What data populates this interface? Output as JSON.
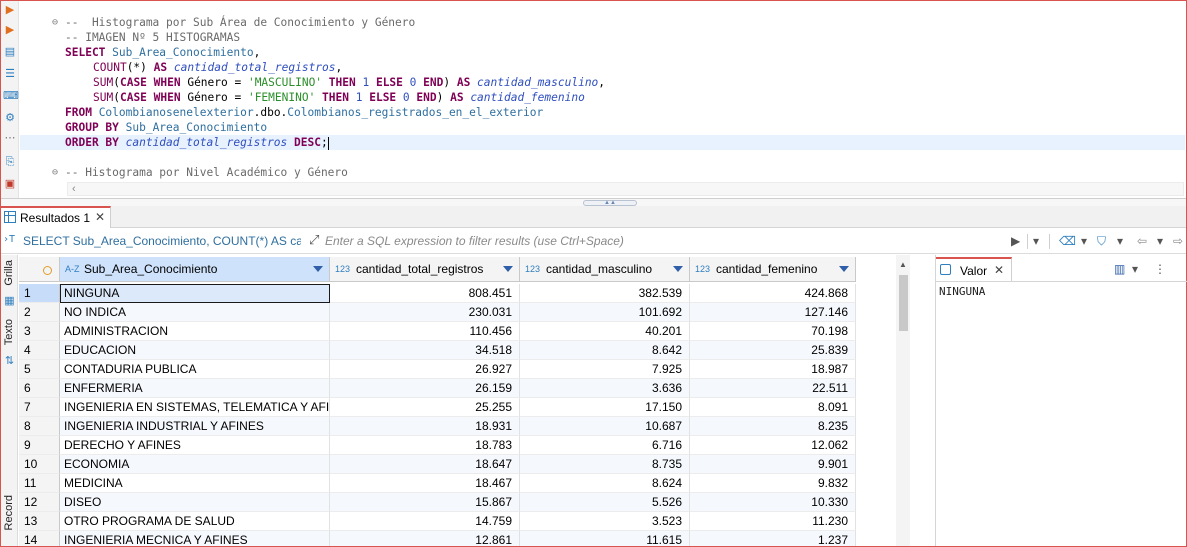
{
  "editor": {
    "lines": [
      {
        "parts": [
          {
            "t": "--  Histograma por Sub Área de Conocimiento y Género",
            "c": "cm"
          }
        ],
        "fold": "⊖",
        "indent": 0
      },
      {
        "parts": [
          {
            "t": "-- IMAGEN Nº 5 HISTOGRAMAS",
            "c": "cm"
          }
        ],
        "indent": 0
      },
      {
        "parts": [
          {
            "t": "SELECT ",
            "c": "kw"
          },
          {
            "t": "Sub_Area_Conocimiento",
            "c": "id"
          },
          {
            "t": ",",
            "c": "op"
          }
        ],
        "indent": 0
      },
      {
        "parts": [
          {
            "t": "COUNT",
            "c": "fn"
          },
          {
            "t": "(*) ",
            "c": "op"
          },
          {
            "t": "AS ",
            "c": "kw"
          },
          {
            "t": "cantidad_total_registros",
            "c": "al"
          },
          {
            "t": ",",
            "c": "op"
          }
        ],
        "indent": 4
      },
      {
        "parts": [
          {
            "t": "SUM",
            "c": "fn"
          },
          {
            "t": "(",
            "c": "op"
          },
          {
            "t": "CASE WHEN ",
            "c": "kw"
          },
          {
            "t": "Género = ",
            "c": "op"
          },
          {
            "t": "'MASCULINO'",
            "c": "st"
          },
          {
            "t": " THEN ",
            "c": "kw"
          },
          {
            "t": "1",
            "c": "nm"
          },
          {
            "t": " ELSE ",
            "c": "kw"
          },
          {
            "t": "0",
            "c": "nm"
          },
          {
            "t": " END",
            "c": "kw"
          },
          {
            "t": ") ",
            "c": "op"
          },
          {
            "t": "AS ",
            "c": "kw"
          },
          {
            "t": "cantidad_masculino",
            "c": "al"
          },
          {
            "t": ",",
            "c": "op"
          }
        ],
        "indent": 4
      },
      {
        "parts": [
          {
            "t": "SUM",
            "c": "fn"
          },
          {
            "t": "(",
            "c": "op"
          },
          {
            "t": "CASE WHEN ",
            "c": "kw"
          },
          {
            "t": "Género = ",
            "c": "op"
          },
          {
            "t": "'FEMENINO'",
            "c": "st"
          },
          {
            "t": " THEN ",
            "c": "kw"
          },
          {
            "t": "1",
            "c": "nm"
          },
          {
            "t": " ELSE ",
            "c": "kw"
          },
          {
            "t": "0",
            "c": "nm"
          },
          {
            "t": " END",
            "c": "kw"
          },
          {
            "t": ") ",
            "c": "op"
          },
          {
            "t": "AS ",
            "c": "kw"
          },
          {
            "t": "cantidad_femenino",
            "c": "al"
          }
        ],
        "indent": 4
      },
      {
        "parts": [
          {
            "t": "FROM ",
            "c": "kw"
          },
          {
            "t": "Colombianosenelexterior",
            "c": "id"
          },
          {
            "t": ".dbo.",
            "c": "op"
          },
          {
            "t": "Colombianos_registrados_en_el_exterior",
            "c": "id"
          }
        ],
        "indent": 0
      },
      {
        "parts": [
          {
            "t": "GROUP BY ",
            "c": "kw"
          },
          {
            "t": "Sub_Area_Conocimiento",
            "c": "id"
          }
        ],
        "indent": 0
      },
      {
        "parts": [
          {
            "t": "ORDER BY ",
            "c": "kw"
          },
          {
            "t": "cantidad_total_registros",
            "c": "al"
          },
          {
            "t": " DESC",
            "c": "kw"
          },
          {
            "t": ";",
            "c": "op"
          }
        ],
        "indent": 0,
        "current": true
      },
      {
        "parts": [],
        "indent": 0
      },
      {
        "parts": [
          {
            "t": "-- Histograma por Nivel Académico y Género",
            "c": "cm"
          }
        ],
        "fold": "⊖",
        "indent": 0
      }
    ]
  },
  "results_tab": {
    "label": "Resultados 1"
  },
  "filter_bar": {
    "query_preview": "SELECT Sub_Area_Conocimiento, COUNT(*) AS canti",
    "placeholder": "Enter a SQL expression to filter results (use Ctrl+Space)"
  },
  "side_panel": {
    "grid_label": "Grilla",
    "text_label": "Texto",
    "record_label": "Record"
  },
  "grid": {
    "columns": [
      {
        "type": "A-Z",
        "name": "Sub_Area_Conocimiento"
      },
      {
        "type": "123",
        "name": "cantidad_total_registros"
      },
      {
        "type": "123",
        "name": "cantidad_masculino"
      },
      {
        "type": "123",
        "name": "cantidad_femenino"
      }
    ],
    "rows": [
      {
        "n": "1",
        "area": "NINGUNA",
        "total": "808.451",
        "masc": "382.539",
        "fem": "424.868"
      },
      {
        "n": "2",
        "area": "NO INDICA",
        "total": "230.031",
        "masc": "101.692",
        "fem": "127.146"
      },
      {
        "n": "3",
        "area": "ADMINISTRACION",
        "total": "110.456",
        "masc": "40.201",
        "fem": "70.198"
      },
      {
        "n": "4",
        "area": "EDUCACION",
        "total": "34.518",
        "masc": "8.642",
        "fem": "25.839"
      },
      {
        "n": "5",
        "area": "CONTADURIA PUBLICA",
        "total": "26.927",
        "masc": "7.925",
        "fem": "18.987"
      },
      {
        "n": "6",
        "area": "ENFERMERIA",
        "total": "26.159",
        "masc": "3.636",
        "fem": "22.511"
      },
      {
        "n": "7",
        "area": "INGENIERIA EN SISTEMAS, TELEMATICA Y AFINES",
        "total": "25.255",
        "masc": "17.150",
        "fem": "8.091"
      },
      {
        "n": "8",
        "area": "INGENIERIA INDUSTRIAL Y AFINES",
        "total": "18.931",
        "masc": "10.687",
        "fem": "8.235"
      },
      {
        "n": "9",
        "area": "DERECHO Y AFINES",
        "total": "18.783",
        "masc": "6.716",
        "fem": "12.062"
      },
      {
        "n": "10",
        "area": "ECONOMIA",
        "total": "18.647",
        "masc": "8.735",
        "fem": "9.901"
      },
      {
        "n": "11",
        "area": "MEDICINA",
        "total": "18.467",
        "masc": "8.624",
        "fem": "9.832"
      },
      {
        "n": "12",
        "area": "DISEO",
        "total": "15.867",
        "masc": "5.526",
        "fem": "10.330"
      },
      {
        "n": "13",
        "area": "OTRO PROGRAMA DE SALUD",
        "total": "14.759",
        "masc": "3.523",
        "fem": "11.230"
      },
      {
        "n": "14",
        "area": "INGENIERIA MECNICA Y AFINES",
        "total": "12.861",
        "masc": "11.615",
        "fem": "1.237"
      }
    ]
  },
  "value_panel": {
    "tab_label": "Valor",
    "value": "NINGUNA"
  }
}
